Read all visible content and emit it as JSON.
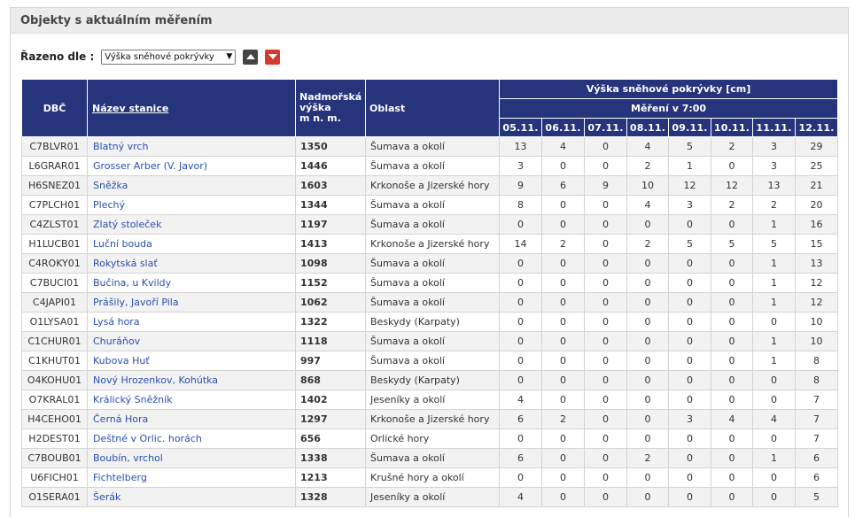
{
  "panel": {
    "title": "Objekty s aktuálním měřením"
  },
  "sort": {
    "label": "Řazeno dle :",
    "selected": "Výška sněhové pokrývky"
  },
  "table": {
    "headers": {
      "code": "DBČ",
      "name": "Název stanice",
      "altitude_line1": "Nadmořská",
      "altitude_line2": "výška",
      "altitude_line3": "m n. m.",
      "area": "Oblast",
      "snow": "Výška sněhové pokrývky [cm]",
      "measurement": "Měření v 7:00"
    },
    "dates": [
      "05.11.",
      "06.11.",
      "07.11.",
      "08.11.",
      "09.11.",
      "10.11.",
      "11.11.",
      "12.11."
    ],
    "rows": [
      {
        "code": "C7BLVR01",
        "name": "Blatný vrch",
        "alt": "1350",
        "area": "Šumava a okolí",
        "v": [
          "13",
          "4",
          "0",
          "4",
          "5",
          "2",
          "3",
          "29"
        ]
      },
      {
        "code": "L6GRAR01",
        "name": "Grosser Arber (V. Javor)",
        "alt": "1446",
        "area": "Šumava a okolí",
        "v": [
          "3",
          "0",
          "0",
          "2",
          "1",
          "0",
          "3",
          "25"
        ]
      },
      {
        "code": "H6SNEZ01",
        "name": "Sněžka",
        "alt": "1603",
        "area": "Krkonoše a Jizerské hory",
        "v": [
          "9",
          "6",
          "9",
          "10",
          "12",
          "12",
          "13",
          "21"
        ]
      },
      {
        "code": "C7PLCH01",
        "name": "Plechý",
        "alt": "1344",
        "area": "Šumava a okolí",
        "v": [
          "8",
          "0",
          "0",
          "4",
          "3",
          "2",
          "2",
          "20"
        ]
      },
      {
        "code": "C4ZLST01",
        "name": "Zlatý stoleček",
        "alt": "1197",
        "area": "Šumava a okolí",
        "v": [
          "0",
          "0",
          "0",
          "0",
          "0",
          "0",
          "1",
          "16"
        ]
      },
      {
        "code": "H1LUCB01",
        "name": "Luční bouda",
        "alt": "1413",
        "area": "Krkonoše a Jizerské hory",
        "v": [
          "14",
          "2",
          "0",
          "2",
          "5",
          "5",
          "5",
          "15"
        ]
      },
      {
        "code": "C4ROKY01",
        "name": "Rokytská slať",
        "alt": "1098",
        "area": "Šumava a okolí",
        "v": [
          "0",
          "0",
          "0",
          "0",
          "0",
          "0",
          "1",
          "13"
        ]
      },
      {
        "code": "C7BUCI01",
        "name": "Bučina, u Kvildy",
        "alt": "1152",
        "area": "Šumava a okolí",
        "v": [
          "0",
          "0",
          "0",
          "0",
          "0",
          "0",
          "1",
          "12"
        ]
      },
      {
        "code": "C4JAPI01",
        "name": "Prášily, Javoří Pila",
        "alt": "1062",
        "area": "Šumava a okolí",
        "v": [
          "0",
          "0",
          "0",
          "0",
          "0",
          "0",
          "1",
          "12"
        ]
      },
      {
        "code": "O1LYSA01",
        "name": "Lysá hora",
        "alt": "1322",
        "area": "Beskydy (Karpaty)",
        "v": [
          "0",
          "0",
          "0",
          "0",
          "0",
          "0",
          "0",
          "10"
        ]
      },
      {
        "code": "C1CHUR01",
        "name": "Churáňov",
        "alt": "1118",
        "area": "Šumava a okolí",
        "v": [
          "0",
          "0",
          "0",
          "0",
          "0",
          "0",
          "1",
          "10"
        ]
      },
      {
        "code": "C1KHUT01",
        "name": "Kubova Huť",
        "alt": "997",
        "area": "Šumava a okolí",
        "v": [
          "0",
          "0",
          "0",
          "0",
          "0",
          "0",
          "1",
          "8"
        ]
      },
      {
        "code": "O4KOHU01",
        "name": "Nový Hrozenkov, Kohútka",
        "alt": "868",
        "area": "Beskydy (Karpaty)",
        "v": [
          "0",
          "0",
          "0",
          "0",
          "0",
          "0",
          "0",
          "8"
        ]
      },
      {
        "code": "O7KRAL01",
        "name": "Králický Sněžník",
        "alt": "1402",
        "area": "Jeseníky a okolí",
        "v": [
          "4",
          "0",
          "0",
          "0",
          "0",
          "0",
          "0",
          "7"
        ]
      },
      {
        "code": "H4CEHO01",
        "name": "Černá Hora",
        "alt": "1297",
        "area": "Krkonoše a Jizerské hory",
        "v": [
          "6",
          "2",
          "0",
          "0",
          "3",
          "4",
          "4",
          "7"
        ]
      },
      {
        "code": "H2DEST01",
        "name": "Deštné v Orlic. horách",
        "alt": "656",
        "area": "Orlické hory",
        "v": [
          "0",
          "0",
          "0",
          "0",
          "0",
          "0",
          "0",
          "7"
        ]
      },
      {
        "code": "C7BOUB01",
        "name": "Boubín, vrchol",
        "alt": "1338",
        "area": "Šumava a okolí",
        "v": [
          "6",
          "0",
          "0",
          "2",
          "0",
          "0",
          "1",
          "6"
        ]
      },
      {
        "code": "U6FICH01",
        "name": "Fichtelberg",
        "alt": "1213",
        "area": "Krušné hory a okolí",
        "v": [
          "0",
          "0",
          "0",
          "0",
          "0",
          "0",
          "0",
          "6"
        ]
      },
      {
        "code": "O1SERA01",
        "name": "Šerák",
        "alt": "1328",
        "area": "Jeseníky a okolí",
        "v": [
          "4",
          "0",
          "0",
          "0",
          "0",
          "0",
          "0",
          "5"
        ]
      }
    ]
  },
  "colors": {
    "header_bg": "#25347b",
    "link": "#2a4fb0",
    "sort_down": "#d23b2f",
    "sort_up": "#444444"
  },
  "icons": {
    "sort_asc": "triangle-up-icon",
    "sort_desc": "triangle-down-icon"
  }
}
